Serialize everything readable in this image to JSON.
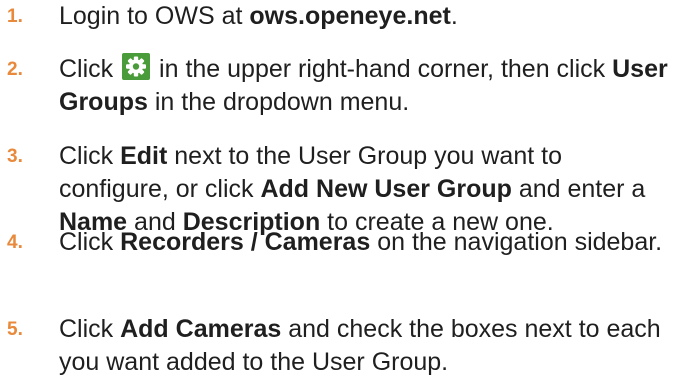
{
  "steps": [
    {
      "number": "1.",
      "segments": [
        {
          "text": "Login to OWS at ",
          "bold": false
        },
        {
          "text": "ows.openeye.net",
          "bold": true
        },
        {
          "text": ".",
          "bold": false
        }
      ]
    },
    {
      "number": "2.",
      "segments": [
        {
          "text": "Click ",
          "bold": false
        },
        {
          "icon": "gear-icon"
        },
        {
          "text": " in the upper right-hand corner, then click ",
          "bold": false
        },
        {
          "text": "User Groups",
          "bold": true
        },
        {
          "text": " in the dropdown menu.",
          "bold": false
        }
      ]
    },
    {
      "number": "3.",
      "segments": [
        {
          "text": "Click ",
          "bold": false
        },
        {
          "text": "Edit",
          "bold": true
        },
        {
          "text": " next to the User Group you want to configure, or click ",
          "bold": false
        },
        {
          "text": "Add New User Group",
          "bold": true
        },
        {
          "text": " and enter a ",
          "bold": false
        },
        {
          "text": "Name",
          "bold": true
        },
        {
          "text": " and ",
          "bold": false
        },
        {
          "text": "Description",
          "bold": true
        },
        {
          "text": " to create a new one.",
          "bold": false
        }
      ]
    },
    {
      "number": "4.",
      "segments": [
        {
          "text": "Click ",
          "bold": false
        },
        {
          "text": "Recorders / Cameras",
          "bold": true
        },
        {
          "text": " on the navigation sidebar.",
          "bold": false
        }
      ]
    },
    {
      "number": "5.",
      "segments": [
        {
          "text": "Click ",
          "bold": false
        },
        {
          "text": "Add Cameras",
          "bold": true
        },
        {
          "text": " and check the boxes next to each you want added to the User Group.",
          "bold": false
        }
      ]
    }
  ],
  "colors": {
    "step_number": "#e8893b",
    "text": "#1f1f1f",
    "icon_background": "#4a9b3a"
  }
}
